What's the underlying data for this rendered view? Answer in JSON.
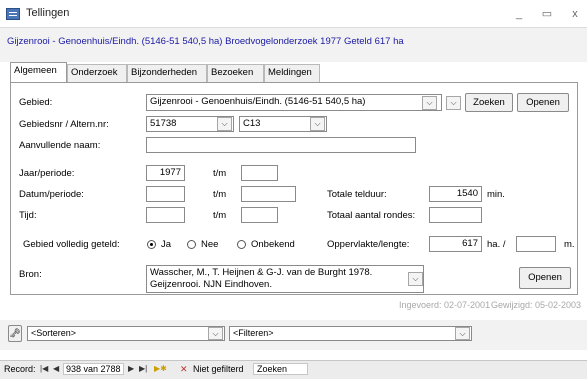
{
  "window": {
    "title": "Tellingen",
    "minimize": "_",
    "maximize": "▭",
    "close": "x"
  },
  "header": {
    "text": "Gijzenrooi - Genoenhuis/Eindh. (5146-51 540,5 ha) Broedvogelonderzoek 1977 Geteld 617 ha"
  },
  "tabs": [
    {
      "label": "Algemeen",
      "active": true
    },
    {
      "label": "Onderzoek"
    },
    {
      "label": "Bijzonderheden"
    },
    {
      "label": "Bezoeken"
    },
    {
      "label": "Meldingen"
    }
  ],
  "form": {
    "gebied_label": "Gebied:",
    "gebied_value": "Gijzenrooi - Genoenhuis/Eindh. (5146-51 540,5 ha)",
    "zoeken_label": "Zoeken",
    "openen_label": "Openen",
    "gebiedsnr_label": "Gebiedsnr / Altern.nr:",
    "gebiedsnr_value": "51738",
    "altern_value": "C13",
    "aanvullende_label": "Aanvullende naam:",
    "aanvullende_value": "",
    "jaar_label": "Jaar/periode:",
    "jaar_value": "1977",
    "tm": "t/m",
    "datum_label": "Datum/periode:",
    "tijd_label": "Tijd:",
    "totale_telduur_label": "Totale telduur:",
    "totale_telduur_value": "1540",
    "min_label": "min.",
    "totaal_rondes_label": "Totaal aantal rondes:",
    "volledig_label": "Gebied volledig geteld:",
    "radio_ja": "Ja",
    "radio_nee": "Nee",
    "radio_onbekend": "Onbekend",
    "selected_radio": "Ja",
    "oppervlakte_label": "Oppervlakte/lengte:",
    "oppervlakte_value": "617",
    "ha_label": "ha.  /",
    "m_label": "m.",
    "bron_label": "Bron:",
    "bron_value": "Wasscher, M., T. Heijnen & G-J. van de Burght 1978. Geijzenrooi. NJN Eindhoven.",
    "bron_openen": "Openen"
  },
  "meta": {
    "ingevoerd": "Ingevoerd: 02-07-2001",
    "gewijzigd": "Gewijzigd: 05-02-2003"
  },
  "footer": {
    "sorteren": "<Sorteren>",
    "filteren": "<Filteren>"
  },
  "recordbar": {
    "record_label": "Record:",
    "position": "938 van 2788",
    "filter_status": "Niet gefilterd",
    "search": "Zoeken"
  }
}
